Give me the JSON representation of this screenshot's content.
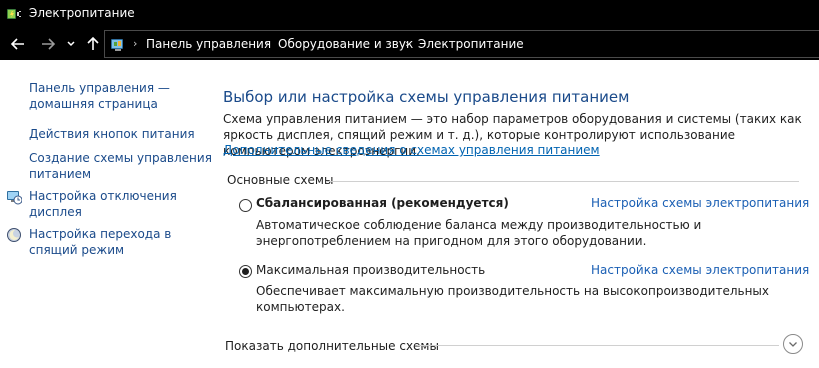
{
  "window": {
    "title": "Электропитание",
    "app_icon": "power-options-icon"
  },
  "nav": {
    "back_icon": "arrow-left-icon",
    "forward_icon": "arrow-right-icon",
    "recent_icon": "chevron-down-icon",
    "up_icon": "arrow-up-icon"
  },
  "address": {
    "icon": "control-panel-icon",
    "crumbs": [
      "Панель управления",
      "Оборудование и звук",
      "Электропитание"
    ]
  },
  "sidebar": {
    "home_link": [
      "Панель управления —",
      "домашняя страница"
    ],
    "items": [
      {
        "label_lines": [
          "Действия кнопок питания"
        ],
        "icon": null
      },
      {
        "label_lines": [
          "Создание схемы управления",
          "питанием"
        ],
        "icon": null
      },
      {
        "label_lines": [
          "Настройка отключения",
          "дисплея"
        ],
        "icon": "display-clock-icon"
      },
      {
        "label_lines": [
          "Настройка перехода в",
          "спящий режим"
        ],
        "icon": "moon-sleep-icon"
      }
    ]
  },
  "main": {
    "heading": "Выбор или настройка схемы управления питанием",
    "intro": "Схема управления питанием — это набор параметров оборудования и системы (таких как яркость дисплея, спящий режим и т. д.), которые контролируют использование компьютером электроэнергии.",
    "intro_link": "Дополнительные сведения о схемах управления питанием",
    "section_label": "Основные схемы",
    "plans": [
      {
        "name": "Сбалансированная (рекомендуется)",
        "selected": false,
        "link": "Настройка схемы электропитания",
        "description": "Автоматическое соблюдение баланса между производительностью и энергопотреблением на пригодном для этого оборудовании."
      },
      {
        "name": "Максимальная производительность",
        "selected": true,
        "link": "Настройка схемы электропитания",
        "description": "Обеспечивает максимальную производительность на высокопроизводительных компьютерах."
      }
    ],
    "more_label": "Показать дополнительные схемы",
    "more_icon": "chevron-circle-down-icon"
  }
}
